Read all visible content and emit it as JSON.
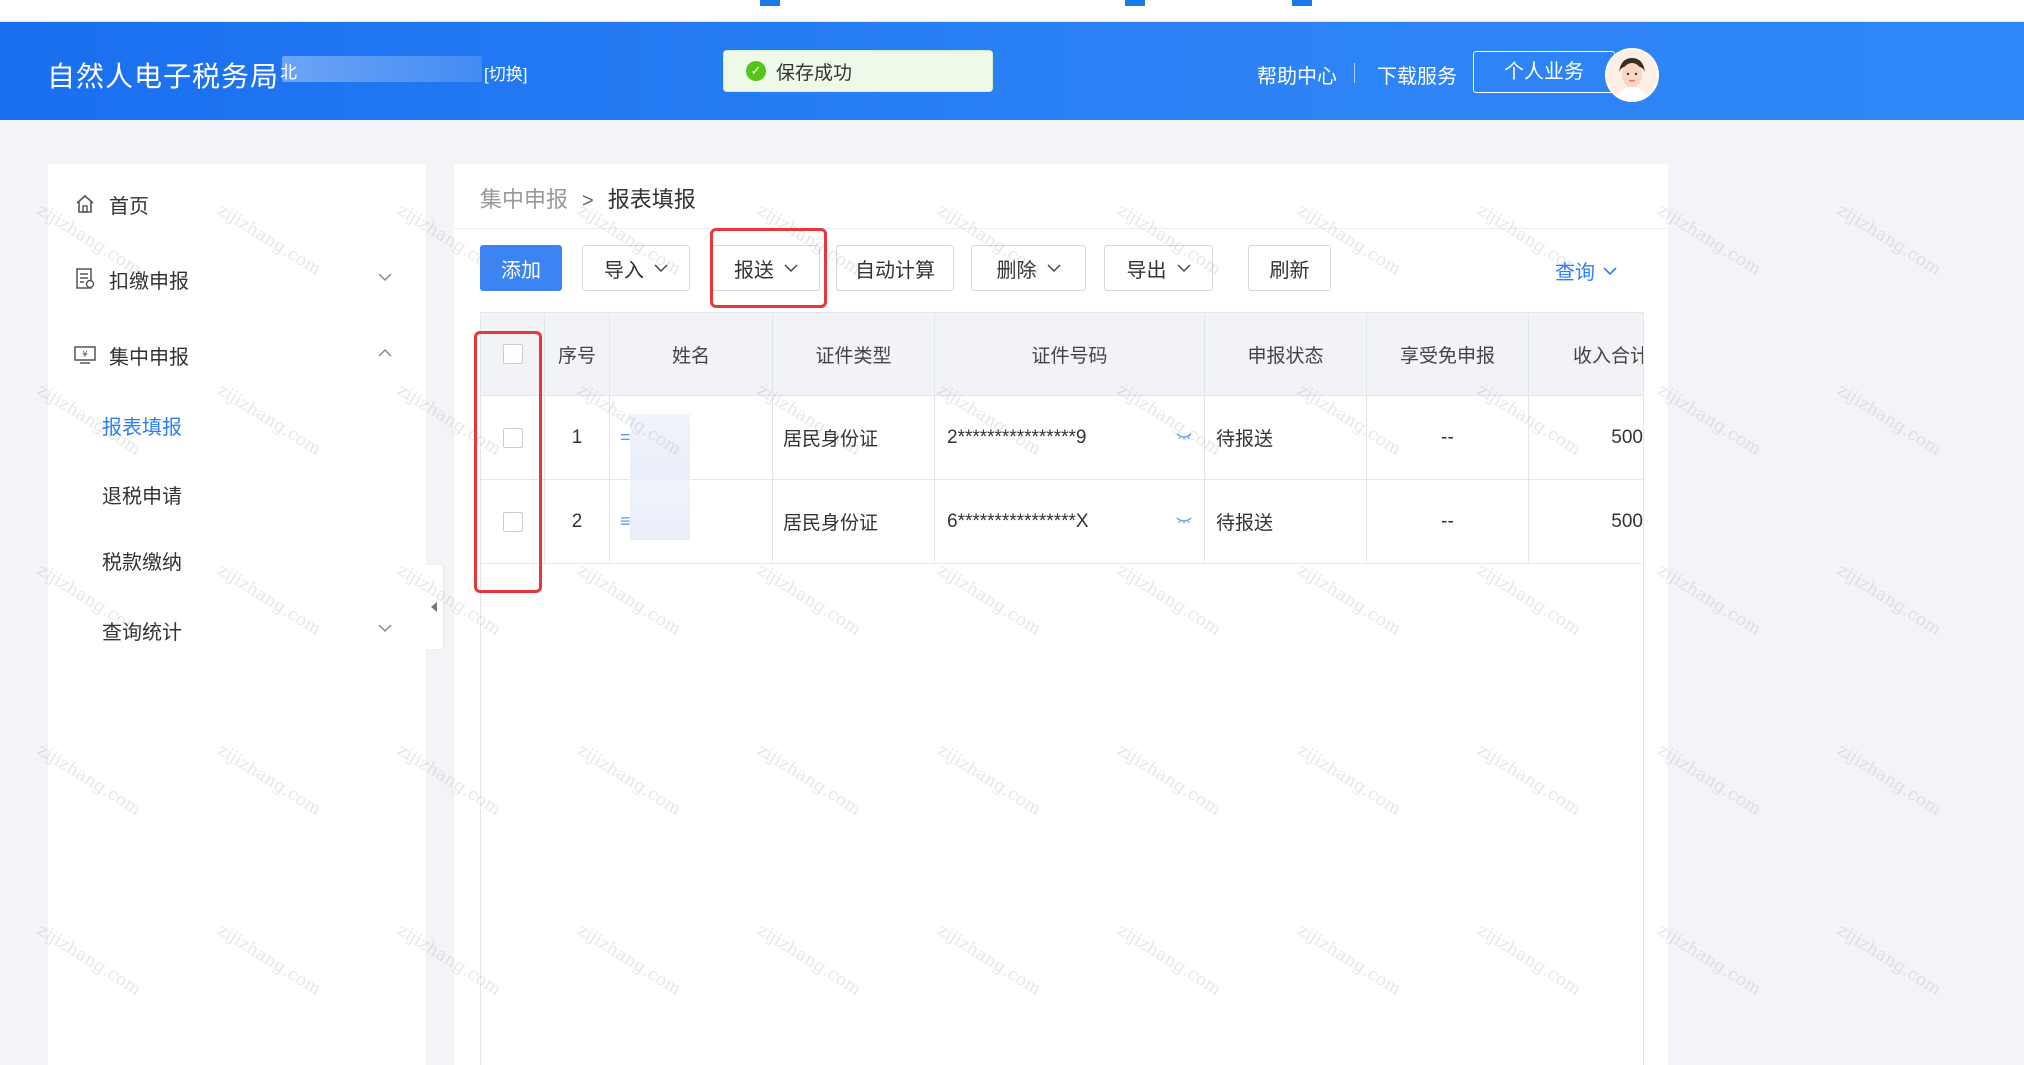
{
  "header": {
    "brand": "自然人电子税务局",
    "brand_suffix": "北",
    "switch_label": "[切换]",
    "toast_text": "保存成功",
    "help_label": "帮助中心",
    "download_label": "下载服务",
    "personal_label": "个人业务"
  },
  "sidebar": {
    "home": "首页",
    "withholding": "扣缴申报",
    "centralized": "集中申报",
    "sub_items": [
      "报表填报",
      "退税申请",
      "税款缴纳"
    ],
    "stats": "查询统计"
  },
  "breadcrumb": {
    "parent": "集中申报",
    "separator": ">",
    "current": "报表填报"
  },
  "toolbar": {
    "add": "添加",
    "import": "导入",
    "submit": "报送",
    "auto_calc": "自动计算",
    "delete": "删除",
    "export": "导出",
    "refresh": "刷新",
    "query": "查询"
  },
  "table": {
    "columns": [
      "序号",
      "姓名",
      "证件类型",
      "证件号码",
      "申报状态",
      "享受免申报",
      "收入合计"
    ],
    "columns_visible": [
      "序号",
      "姓名",
      "证件类型",
      "证件号码",
      "申报状态",
      "享受免申报",
      "收入合计"
    ],
    "rows": [
      {
        "index": "1",
        "name": "=",
        "id_type": "居民身份证",
        "id_number": "2****************9",
        "status": "待报送",
        "exempt": "--",
        "income": "500"
      },
      {
        "index": "2",
        "name": "≡",
        "id_type": "居民身份证",
        "id_number": "6****************X",
        "status": "待报送",
        "exempt": "--",
        "income": "500"
      }
    ]
  },
  "watermark": "zijizhang.com",
  "colors": {
    "header_blue": "#2d83f6",
    "accent": "#2b7ff6",
    "highlight_red": "#e8373a",
    "success": "#52c41a"
  }
}
